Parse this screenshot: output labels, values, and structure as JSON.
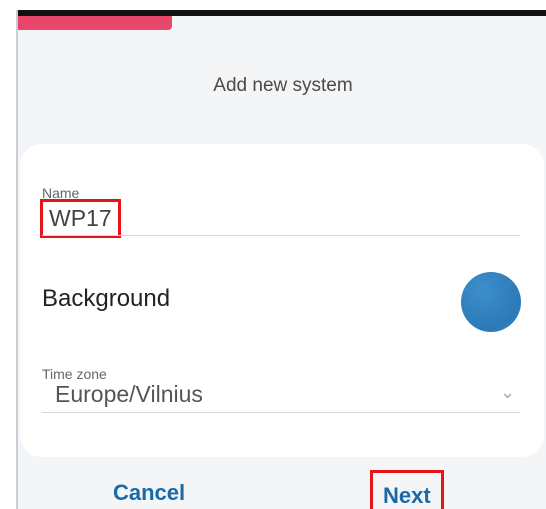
{
  "dialog": {
    "title": "Add new system",
    "progress_fraction": 0.29
  },
  "form": {
    "name_label": "Name",
    "name_value": "WP17",
    "background_label": "Background",
    "background_color": "#2f7fbf",
    "timezone_label": "Time zone",
    "timezone_value": "Europe/Vilnius",
    "timezone_dropdown_icon": "chevron-down-icon"
  },
  "actions": {
    "cancel_label": "Cancel",
    "next_label": "Next"
  },
  "colors": {
    "accent": "#e8466a",
    "button_text": "#1a6aa8",
    "highlight_box": "#e3141a"
  }
}
